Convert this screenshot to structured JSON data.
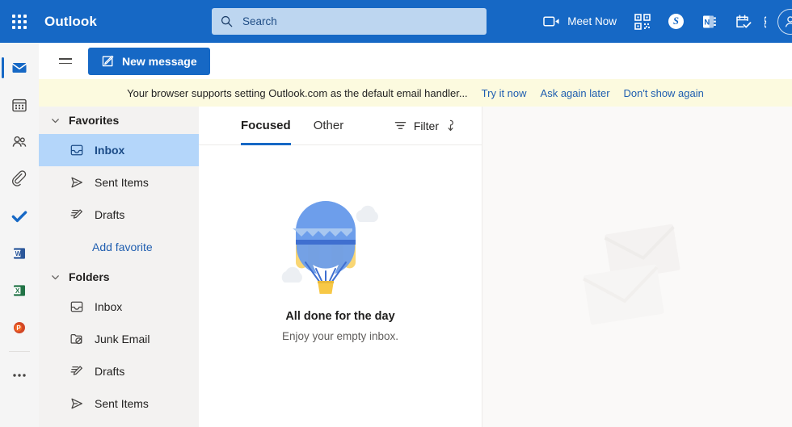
{
  "header": {
    "app_launcher_icon": "waffle-grid-icon",
    "brand": "Outlook",
    "search_placeholder": "Search",
    "search_value": "",
    "search_icon": "search-icon",
    "meet_now_label": "Meet Now",
    "meet_now_icon": "video-camera-icon",
    "qr_icon": "qr-code-icon",
    "skype_icon": "skype-icon",
    "skype_letter": "S",
    "onenote_icon": "onenote-icon",
    "onenote_letter": "N",
    "calendar_check_icon": "calendar-check-icon",
    "settings_icon": "settings-gear-icon",
    "avatar_icon": "account-avatar",
    "bg_color": "#1668c5",
    "search_bg_color": "#bdd6f0"
  },
  "command_bar": {
    "hamburger_icon": "hamburger-menu-icon",
    "new_message_label": "New message",
    "new_message_icon": "compose-icon",
    "accent_color": "#1668c5"
  },
  "banner": {
    "message": "Your browser supports setting Outlook.com as the default email handler...",
    "actions": [
      {
        "label": "Try it now"
      },
      {
        "label": "Ask again later"
      },
      {
        "label": "Don't show again"
      }
    ],
    "bg_color": "#fcfadf",
    "link_color": "#1f5eb0"
  },
  "rail": {
    "items": [
      {
        "name": "mail",
        "icon": "mail-icon",
        "active": true
      },
      {
        "name": "calendar",
        "icon": "calendar-icon",
        "active": false
      },
      {
        "name": "people",
        "icon": "people-icon",
        "active": false
      },
      {
        "name": "files",
        "icon": "attachment-paperclip-icon",
        "active": false
      },
      {
        "name": "to-do",
        "icon": "checkmark-icon",
        "active": false
      },
      {
        "name": "word",
        "icon": "word-icon",
        "letter": "W",
        "active": false
      },
      {
        "name": "excel",
        "icon": "excel-icon",
        "letter": "X",
        "active": false
      },
      {
        "name": "powerpoint",
        "icon": "powerpoint-icon",
        "letter": "P",
        "active": false
      },
      {
        "name": "more-apps",
        "icon": "ellipsis-icon",
        "active": false
      }
    ]
  },
  "sidebar": {
    "favorites": {
      "label": "Favorites",
      "chevron_icon": "chevron-down-icon",
      "expanded": true,
      "items": [
        {
          "label": "Inbox",
          "icon": "inbox-icon",
          "selected": true
        },
        {
          "label": "Sent Items",
          "icon": "send-icon",
          "selected": false
        },
        {
          "label": "Drafts",
          "icon": "drafts-pencil-icon",
          "selected": false
        }
      ],
      "add_favorite_label": "Add favorite"
    },
    "folders": {
      "label": "Folders",
      "chevron_icon": "chevron-down-icon",
      "expanded": true,
      "items": [
        {
          "label": "Inbox",
          "icon": "inbox-icon"
        },
        {
          "label": "Junk Email",
          "icon": "junk-folder-icon"
        },
        {
          "label": "Drafts",
          "icon": "drafts-pencil-icon"
        },
        {
          "label": "Sent Items",
          "icon": "send-icon"
        }
      ]
    },
    "selected_bg_color": "#b4d6fa",
    "bg_color": "#f3f2f1"
  },
  "message_list": {
    "tabs": [
      {
        "label": "Focused",
        "active": true
      },
      {
        "label": "Other",
        "active": false
      }
    ],
    "filter_label": "Filter",
    "filter_icon": "filter-icon",
    "sort_icon": "sort-arrow-down-icon",
    "empty_state": {
      "illustration": "hot-air-balloon-illustration",
      "title": "All done for the day",
      "subtitle": "Enjoy your empty inbox."
    }
  },
  "reading_pane": {
    "watermark_icon": "envelopes-watermark",
    "bg_color": "#faf9f8"
  }
}
